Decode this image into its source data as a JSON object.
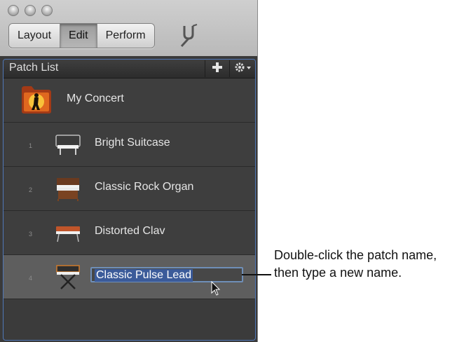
{
  "window": {
    "traffic_lights": [
      "close",
      "minimize",
      "zoom"
    ]
  },
  "toolbar": {
    "modes": [
      {
        "label": "Layout",
        "active": false
      },
      {
        "label": "Edit",
        "active": true
      },
      {
        "label": "Perform",
        "active": false
      }
    ],
    "tuning_icon": "tuning-fork-icon"
  },
  "patch_list": {
    "title": "Patch List",
    "add_icon": "plus-icon",
    "action_icon": "gear-icon",
    "concert": {
      "name": "My Concert",
      "icon": "concert-folder-icon"
    },
    "patches": [
      {
        "number": "1",
        "name": "Bright Suitcase",
        "icon": "electric-piano-icon"
      },
      {
        "number": "2",
        "name": "Classic Rock Organ",
        "icon": "organ-icon"
      },
      {
        "number": "3",
        "name": "Distorted Clav",
        "icon": "clavinet-icon"
      },
      {
        "number": "4",
        "name": "Classic Pulse Lead",
        "icon": "synthesizer-icon",
        "editing": true
      }
    ]
  },
  "annotation": {
    "text": "Double-click the patch name, then type a new name."
  },
  "colors": {
    "panel_bg": "#3e3e3e",
    "selected_row": "#5e5e5e",
    "focus_border": "#5078b8",
    "text_selection": "#3b5b9a"
  }
}
